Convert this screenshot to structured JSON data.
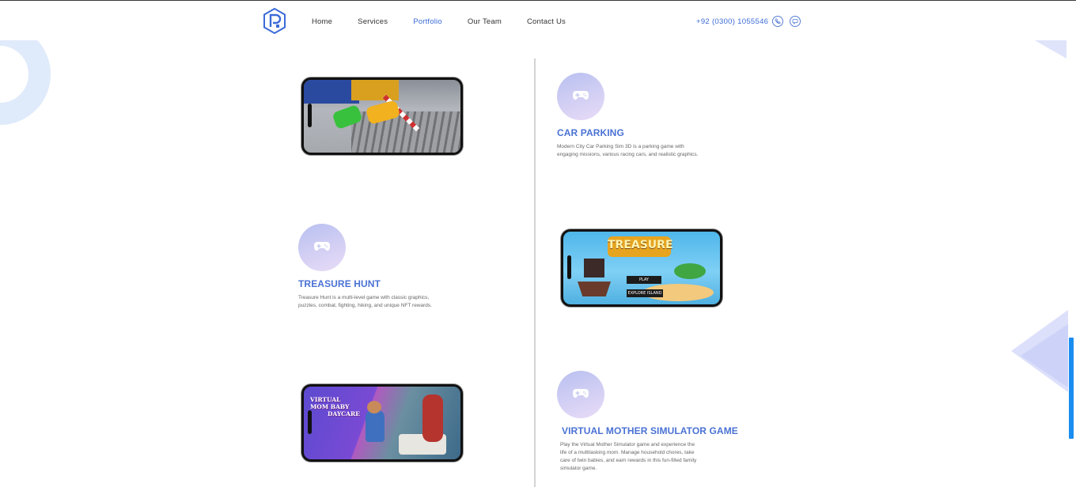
{
  "header": {
    "nav": [
      "Home",
      "Services",
      "Portfolio",
      "Our Team",
      "Contact Us"
    ],
    "active_nav": "Portfolio",
    "phone": "+92 (0300) 1055546",
    "icons": [
      "phone-icon",
      "chat-icon"
    ]
  },
  "portfolio": {
    "items": [
      {
        "title": "CAR PARKING",
        "desc_lines": [
          "Modern City Car Parking Sim 3D is a parking game with",
          "engaging missions, various racing cars, and realistic graphics."
        ]
      },
      {
        "title": "TREASURE HUNT",
        "desc_lines": [
          "Treasure Hunt is a multi-level game with classic graphics,",
          "puzzles, combat, fighting, hiking, and unique NFT rewards."
        ],
        "screen": {
          "logo": "TREASURE",
          "play": "PLAY",
          "explore": "EXPLORE ISLAND"
        }
      },
      {
        "title": "VIRTUAL MOTHER SIMULATOR GAME",
        "desc_lines": [
          "Play the Virtual Mother Simulator game and experience the",
          "life of a multitasking mom. Manage household chores, take",
          "care of twin babies, and earn rewards in this fun-filled family",
          "simulator game."
        ],
        "screen": {
          "title_lines": [
            "VIRTUAL",
            "MOM BABY",
            "DAYCARE"
          ]
        }
      }
    ]
  },
  "colors": {
    "accent": "#3c6bd8",
    "title": "#4a72d4",
    "scrollbar": "#1a8df0"
  }
}
